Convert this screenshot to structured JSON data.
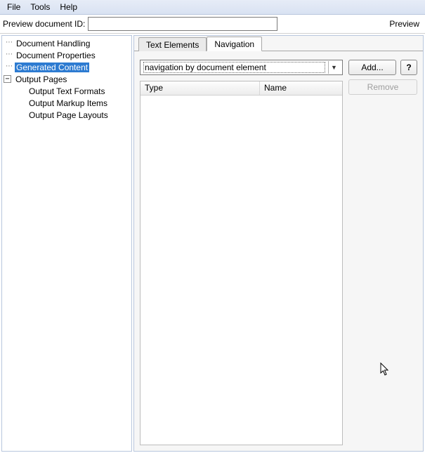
{
  "menu": {
    "file": "File",
    "tools": "Tools",
    "help": "Help"
  },
  "preview": {
    "label": "Preview document ID:",
    "value": "",
    "link": "Preview"
  },
  "tree": {
    "docHandling": "Document Handling",
    "docProperties": "Document Properties",
    "generatedContent": "Generated Content",
    "outputPages": "Output Pages",
    "outputTextFormats": "Output Text Formats",
    "outputMarkupItems": "Output Markup Items",
    "outputPageLayouts": "Output Page Layouts"
  },
  "tabs": {
    "textElements": "Text Elements",
    "navigation": "Navigation"
  },
  "dropdown": {
    "selected": "navigation by document element"
  },
  "buttons": {
    "add": "Add...",
    "help": "?",
    "remove": "Remove"
  },
  "columns": {
    "type": "Type",
    "name": "Name"
  }
}
